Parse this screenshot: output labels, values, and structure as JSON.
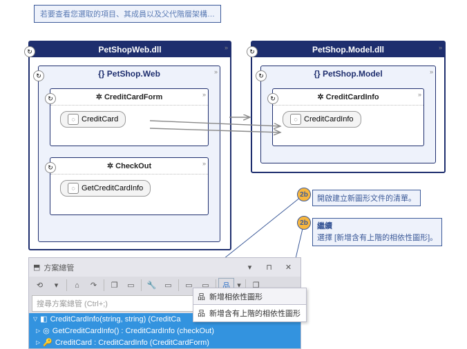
{
  "tooltip": "若要查看您選取的項目、其成員以及父代階層架構…",
  "callouts": {
    "c1": "開啟建立新圖形文件的清單。",
    "c2_title": "繼續",
    "c2": "選擇 [新增含有上階的相依性圖形]。"
  },
  "badge": "2b",
  "left": {
    "dll": "PetShopWeb.dll",
    "ns": "PetShop.Web",
    "cls1": "CreditCardForm",
    "cls1_field": "CreditCard",
    "cls2": "CheckOut",
    "cls2_field": "GetCreditCardInfo"
  },
  "right": {
    "dll": "PetShop.Model.dll",
    "ns": "PetShop.Model",
    "cls": "CreditCardInfo",
    "cls_field": "CreditCardInfo"
  },
  "panel": {
    "title": "方案總管",
    "search": "搜尋方案總管 (Ctrl+;)",
    "rows": {
      "r1": "CreditCardInfo(string, string) (CreditCa",
      "r2": "GetCreditCardInfo() : CreditCardInfo (checkOut)",
      "r3": "CreditCard : CreditCardInfo (CreditCardForm)"
    }
  },
  "menu": {
    "m1": "新增相依性圖形",
    "m2": "新增含有上階的相依性圖形"
  },
  "glyphs": {
    "braces": "{}",
    "gear": "✲",
    "refresh": "↻",
    "chev": "»",
    "dot": "◌",
    "home": "⌂",
    "back": "⟲",
    "fwd": "↷",
    "wrench": "🔧",
    "graph": "品",
    "dd": "▾",
    "newwin": "❐",
    "search": "🔍",
    "tri_r": "▷",
    "tri_d": "▽",
    "pin": "⊓",
    "x": "✕",
    "key": "🔑",
    "box": "▭"
  }
}
